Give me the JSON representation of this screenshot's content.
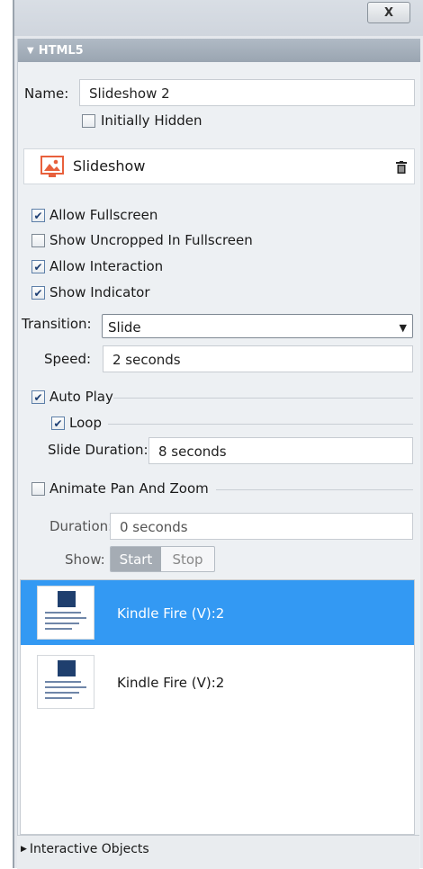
{
  "window": {
    "close_glyph": "X"
  },
  "section": {
    "title": "HTML5",
    "collapse_icon": "triangle-down-icon"
  },
  "object": {
    "name_label": "Name:",
    "name_value": "Slideshow 2",
    "initially_hidden_label": "Initially Hidden",
    "initially_hidden": false
  },
  "component": {
    "title": "Slideshow",
    "icon": "slideshow-icon",
    "delete_icon": "trash-icon",
    "accent": "#e8603c"
  },
  "options": {
    "allow_fullscreen": {
      "label": "Allow Fullscreen",
      "checked": true
    },
    "show_uncropped": {
      "label": "Show Uncropped In Fullscreen",
      "checked": false
    },
    "allow_interaction": {
      "label": "Allow Interaction",
      "checked": true
    },
    "show_indicator": {
      "label": "Show Indicator",
      "checked": true
    }
  },
  "transition": {
    "label": "Transition:",
    "value": "Slide"
  },
  "speed": {
    "label": "Speed:",
    "value": "2 seconds"
  },
  "autoplay": {
    "label": "Auto Play",
    "checked": true,
    "loop_label": "Loop",
    "loop_checked": true,
    "slide_duration_label": "Slide Duration:",
    "slide_duration_value": "8 seconds"
  },
  "pan_zoom": {
    "label": "Animate Pan And Zoom",
    "checked": false,
    "duration_label": "Duration:",
    "duration_value": "0 seconds",
    "show_label": "Show:",
    "show_options": [
      "Start",
      "Stop"
    ],
    "show_selected": "Start"
  },
  "slides": [
    {
      "name": "Kindle Fire (V):2",
      "selected": true
    },
    {
      "name": "Kindle Fire (V):2",
      "selected": false
    }
  ],
  "list_toolbar": {
    "add_icon": "add-icon",
    "edit_icon": "pencil-icon",
    "clapper_icon": "clapperboard-icon",
    "delete_icon": "trash-icon"
  },
  "footer": {
    "label": "Interactive Objects",
    "expand_icon": "triangle-right-icon"
  },
  "colors": {
    "selection": "#3399f3",
    "header": "#a3adb9"
  }
}
